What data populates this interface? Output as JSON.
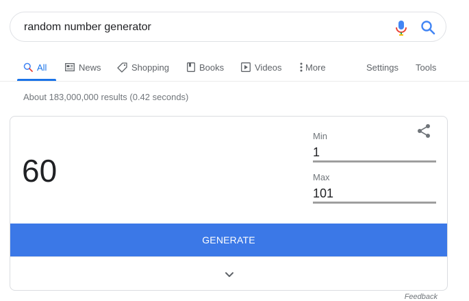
{
  "search": {
    "query": "random number generator"
  },
  "tabs": [
    {
      "label": "All",
      "icon": "search-icon",
      "active": true
    },
    {
      "label": "News",
      "icon": "news-icon"
    },
    {
      "label": "Shopping",
      "icon": "tag-icon"
    },
    {
      "label": "Books",
      "icon": "book-icon"
    },
    {
      "label": "Videos",
      "icon": "play-icon"
    },
    {
      "label": "More",
      "icon": "more-vert-icon"
    }
  ],
  "tools": {
    "settings_label": "Settings",
    "tools_label": "Tools"
  },
  "results": {
    "stats": "About 183,000,000 results (0.42 seconds)"
  },
  "generator": {
    "result": "60",
    "min_label": "Min",
    "min_value": "1",
    "max_label": "Max",
    "max_value": "101",
    "generate_label": "GENERATE"
  },
  "footer": {
    "feedback_label": "Feedback"
  },
  "colors": {
    "accent": "#1a73e8",
    "generate_bg": "#3b78e7",
    "muted_text": "#70757a"
  }
}
